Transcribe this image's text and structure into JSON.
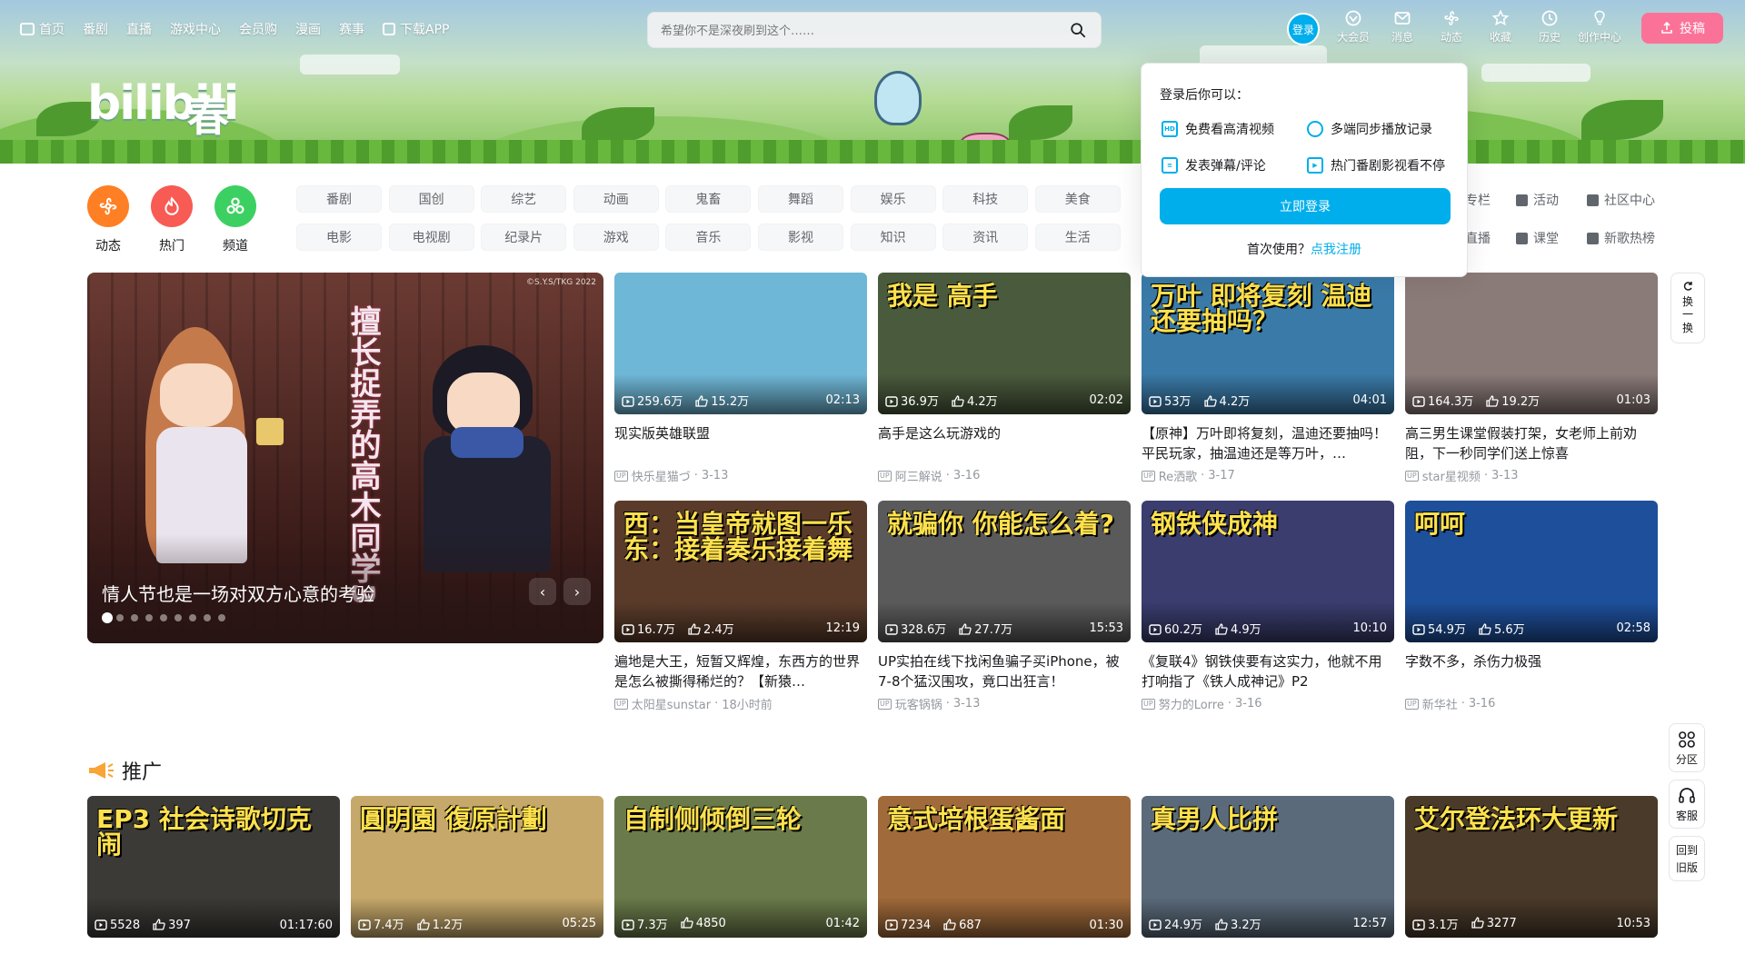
{
  "header": {
    "nav": [
      "首页",
      "番剧",
      "直播",
      "游戏中心",
      "会员购",
      "漫画",
      "赛事",
      "下载APP"
    ],
    "search_placeholder": "希望你不是深夜刷到这个……",
    "login_label": "登录",
    "right_icons": [
      "大会员",
      "消息",
      "动态",
      "收藏",
      "历史",
      "创作中心"
    ],
    "upload_label": "投稿"
  },
  "banner": {
    "logo_text": "bilibili",
    "logo_extra": "春"
  },
  "channels": [
    {
      "label": "动态",
      "color": "#ff7f24"
    },
    {
      "label": "热门",
      "color": "#f85a54"
    },
    {
      "label": "频道",
      "color": "#3cd063"
    }
  ],
  "tags_row1": [
    "番剧",
    "国创",
    "综艺",
    "动画",
    "鬼畜",
    "舞蹈",
    "娱乐",
    "科技",
    "美食"
  ],
  "tags_row2": [
    "电影",
    "电视剧",
    "纪录片",
    "游戏",
    "音乐",
    "影视",
    "知识",
    "资讯",
    "生活"
  ],
  "side_links_row1": [
    "专栏",
    "活动",
    "社区中心"
  ],
  "side_links_row2": [
    "直播",
    "课堂",
    "新歌热榜"
  ],
  "hero": {
    "title": "情人节也是一场对双方心意的考验",
    "vertical_text": "擅长捉弄的高木同学3",
    "copyright": "©S.Y.S/TKG 2022",
    "prev": "‹",
    "next": "›",
    "dot_count": 9
  },
  "refresh_label": [
    "换",
    "一",
    "换"
  ],
  "videos": [
    {
      "views": "259.6万",
      "likes": "15.2万",
      "duration": "02:13",
      "title": "现实版英雄联盟",
      "author": "快乐星猫づ",
      "date": "3-13",
      "bg": "#6fb7d6",
      "overlay": ""
    },
    {
      "views": "36.9万",
      "likes": "4.2万",
      "duration": "02:02",
      "title": "高手是这么玩游戏的",
      "author": "阿三解说",
      "date": "3-16",
      "bg": "#4a5a3c",
      "overlay": "我是 高手"
    },
    {
      "views": "53万",
      "likes": "4.2万",
      "duration": "04:01",
      "title": "【原神】万叶即将复刻，温迪还要抽吗！平民玩家，抽温迪还是等万叶，…",
      "author": "Re洒歌",
      "date": "3-17",
      "bg": "#3a7aa8",
      "overlay": "万叶 即将复刻 温迪还要抽吗？"
    },
    {
      "views": "164.3万",
      "likes": "19.2万",
      "duration": "01:03",
      "title": "高三男生课堂假装打架，女老师上前劝阻，下一秒同学们送上惊喜",
      "author": "star星视频",
      "date": "3-13",
      "bg": "#8a7a78",
      "overlay": ""
    },
    {
      "views": "16.7万",
      "likes": "2.4万",
      "duration": "12:19",
      "title": "遍地是大王，短暂又辉煌，东西方的世界是怎么被撕得稀烂的？【新猿…",
      "author": "太阳星sunstar",
      "date": "18小时前",
      "bg": "#5a3b2a",
      "overlay": "西：当皇帝就图一乐 东：接着奏乐接着舞"
    },
    {
      "views": "328.6万",
      "likes": "27.7万",
      "duration": "15:53",
      "title": "UP实拍在线下找闲鱼骗子买iPhone，被7-8个猛汉围攻，竟口出狂言！",
      "author": "玩客锅锅",
      "date": "3-13",
      "bg": "#5a5a5a",
      "overlay": "就骗你 你能怎么着?"
    },
    {
      "views": "60.2万",
      "likes": "4.9万",
      "duration": "10:10",
      "title": "《复联4》钢铁侠要有这实力，他就不用打响指了《铁人成神记》P2",
      "author": "努力的Lorre",
      "date": "3-16",
      "bg": "#3a3d6e",
      "overlay": "钢铁侠成神"
    },
    {
      "views": "54.9万",
      "likes": "5.6万",
      "duration": "02:58",
      "title": "字数不多，杀伤力极强",
      "author": "新华社",
      "date": "3-16",
      "bg": "#1e4f9a",
      "overlay": "呵呵"
    }
  ],
  "promo": {
    "title": "推广",
    "videos": [
      {
        "views": "5528",
        "likes": "397",
        "duration": "01:17:60",
        "bg": "#3b3a36",
        "overlay": "EP3 社会诗歌切克闹"
      },
      {
        "views": "7.4万",
        "likes": "1.2万",
        "duration": "05:25",
        "bg": "#c6a86a",
        "overlay": "圓明園 復原計劃"
      },
      {
        "views": "7.3万",
        "likes": "4850",
        "duration": "01:42",
        "bg": "#6a7a4a",
        "overlay": "自制侧倾倒三轮"
      },
      {
        "views": "7234",
        "likes": "687",
        "duration": "01:30",
        "bg": "#a06a3a",
        "overlay": "意式培根蛋酱面"
      },
      {
        "views": "24.9万",
        "likes": "3.2万",
        "duration": "12:57",
        "bg": "#5a6a7a",
        "overlay": "真男人比拼"
      },
      {
        "views": "3.1万",
        "likes": "3277",
        "duration": "10:53",
        "bg": "#4a3a2a",
        "overlay": "艾尔登法环大更新"
      }
    ]
  },
  "popup": {
    "title": "登录后你可以：",
    "items": [
      "免费看高清视频",
      "多端同步播放记录",
      "发表弹幕/评论",
      "热门番剧影视看不停"
    ],
    "hd_badge": "HD",
    "login_button": "立即登录",
    "first_use": "首次使用？",
    "register": "点我注册"
  },
  "floating": {
    "category": "分区",
    "service": "客服",
    "old_version": [
      "回到",
      "旧版"
    ]
  }
}
